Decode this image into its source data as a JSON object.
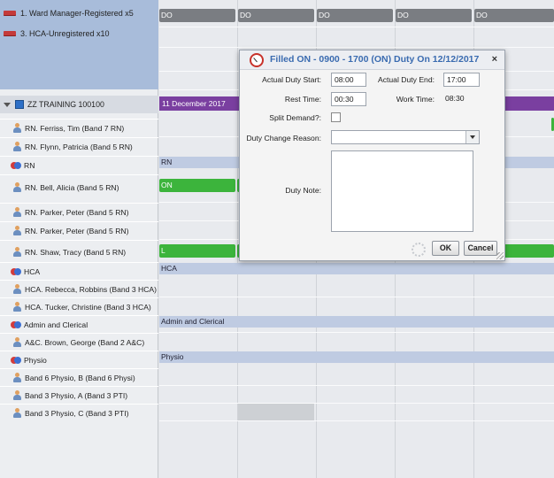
{
  "legend": [
    {
      "label": "1. Ward Manager-Registered x5"
    },
    {
      "label": "3. HCA-Unregistered x10"
    }
  ],
  "day_headers": [
    "DO",
    "DO",
    "DO",
    "DO",
    "DO"
  ],
  "group": {
    "label": "ZZ TRAINING 100100",
    "date_bar": "11 December 2017"
  },
  "rows": [
    {
      "label": "RN. Ferriss, Tim (Band 7 RN)"
    },
    {
      "label": "RN. Flynn, Patricia (Band 5 RN)"
    },
    {
      "label": "RN"
    },
    {
      "label": "RN. Bell, Alicia (Band 5 RN)"
    },
    {
      "label": "RN. Parker, Peter (Band 5 RN)"
    },
    {
      "label": "RN. Parker, Peter (Band 5 RN)"
    },
    {
      "label": "RN. Shaw, Tracy (Band 5 RN)"
    },
    {
      "label": "HCA"
    },
    {
      "label": "HCA. Rebecca, Robbins (Band 3 HCA)"
    },
    {
      "label": "HCA. Tucker, Christine (Band 3 HCA)"
    },
    {
      "label": "Admin and Clerical"
    },
    {
      "label": "A&C. Brown, George (Band 2 A&C)"
    },
    {
      "label": "Physio"
    },
    {
      "label": "Band 6 Physio, B (Band 6 Physi)"
    },
    {
      "label": "Band 3 Physio, A (Band 3 PTI)"
    },
    {
      "label": "Band 3 Physio, C (Band 3 PTI)"
    }
  ],
  "category_bars": {
    "rn": "RN",
    "hca": "HCA",
    "admin": "Admin and Clerical",
    "physio": "Physio"
  },
  "shifts": {
    "bell": "ON",
    "shaw": "L"
  },
  "dialog": {
    "title": "Filled ON - 0900 - 1700 (ON) Duty On 12/12/2017",
    "close": "×",
    "actual_duty_start_label": "Actual Duty Start:",
    "actual_duty_start": "08:00",
    "actual_duty_end_label": "Actual Duty End:",
    "actual_duty_end": "17:00",
    "rest_time_label": "Rest Time:",
    "rest_time": "00:30",
    "work_time_label": "Work Time:",
    "work_time": "08:30",
    "split_demand_label": "Split Demand?:",
    "duty_change_reason_label": "Duty Change Reason:",
    "duty_change_reason": "",
    "duty_note_label": "Duty Note:",
    "ok": "OK",
    "cancel": "Cancel"
  },
  "colors": {
    "accent": "#3a6bb0",
    "shift_green": "#3cb43c",
    "group_purple": "#7a3fa0",
    "legend_red": "#c43a3a"
  }
}
